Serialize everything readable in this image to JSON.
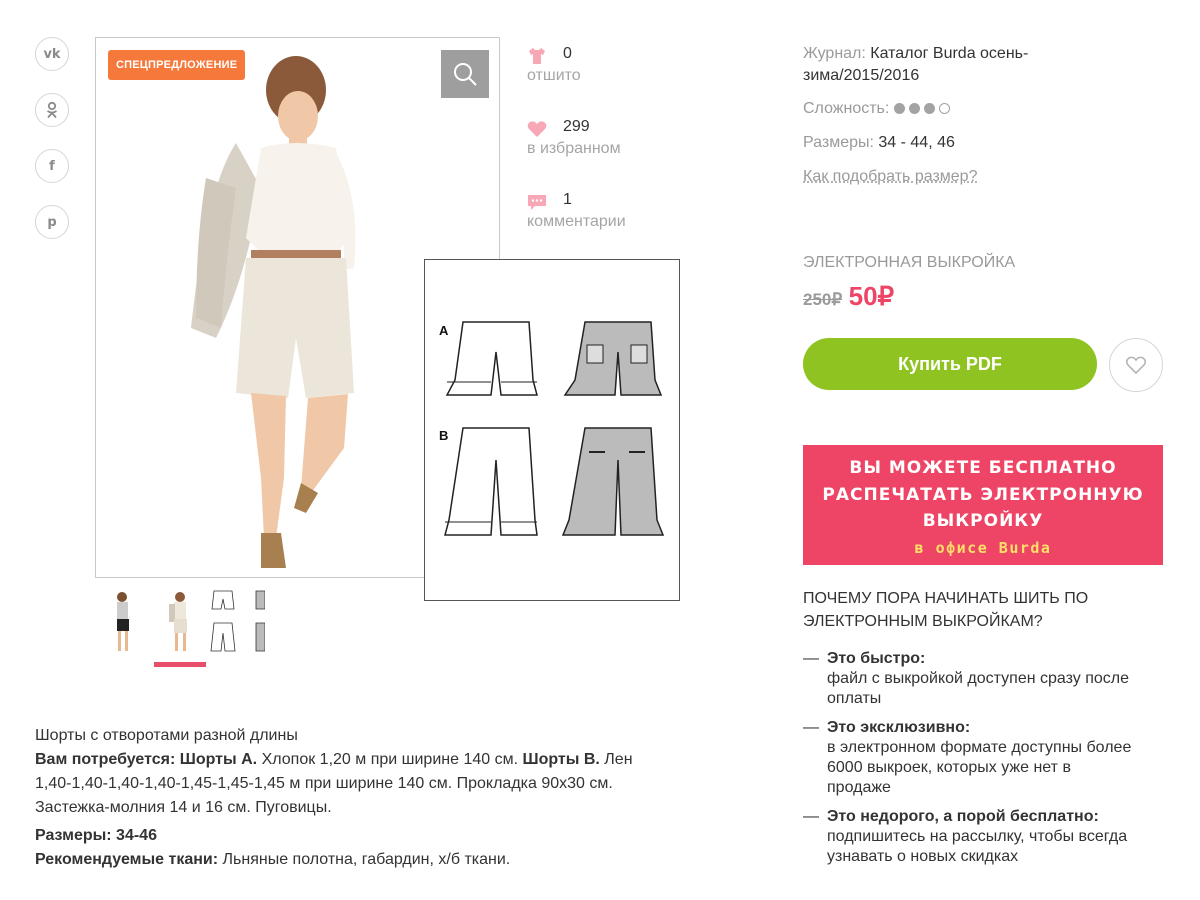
{
  "social": {
    "vk": "vk",
    "ok": "ok",
    "fb": "f",
    "pinterest": "p"
  },
  "gallery": {
    "badge": "СПЕЦПРЕДЛОЖЕНИЕ",
    "badge_color": "#f5793b",
    "active_thumb_index": 1,
    "active_color": "#e94f6a"
  },
  "stats": {
    "sewn_count": "0",
    "sewn_label": "отшито",
    "fav_count": "299",
    "fav_label": "в избранном",
    "comments_count": "1",
    "comments_label": "комментарии"
  },
  "drawing": {
    "view_a": "A",
    "view_b": "B"
  },
  "description": {
    "title": "Шорты с отворотами разной длины",
    "needs_label": "Вам потребуется:",
    "shorts_a_label": "Шорты А.",
    "shorts_a_text": "Хлопок 1,20 м при ширине 140 см.",
    "shorts_b_label": "Шорты В.",
    "shorts_b_text": "Лен 1,40-1,40-1,40-1,40-1,45-1,45-1,45 м при ширине 140 см. Прокладка 90х30 см. Застежка-молния 14 и 16 см. Пуговицы.",
    "sizes": "Размеры: 34-46",
    "fabrics_label": "Рекомендуемые ткани:",
    "fabrics_text": "Льняные полотна, габардин, х/б ткани."
  },
  "info": {
    "magazine_label": "Журнал:",
    "magazine_line1": "Каталог Burda осень-",
    "magazine_line2": "зима/2015/2016",
    "difficulty_label": "Сложность:",
    "difficulty_level": 3,
    "difficulty_max": 4,
    "sizes_label": "Размеры:",
    "sizes_value": "34 - 44, 46",
    "size_help_link": "Как подобрать размер?"
  },
  "purchase": {
    "type_label": "ЭЛЕКТРОННАЯ ВЫКРОЙКА",
    "old_price": "250₽",
    "new_price": "50₽",
    "buy_label": "Купить PDF",
    "buy_color": "#8fc321",
    "price_color": "#ee4466"
  },
  "promo": {
    "line1": "ВЫ МОЖЕТЕ БЕСПЛАТНО",
    "line2": "РАСПЕЧАТАТЬ ЭЛЕКТРОННУЮ",
    "line3": "ВЫКРОЙКУ",
    "line4": "в офисе Burda",
    "bg_color": "#ee4466"
  },
  "why": {
    "heading_line1": "ПОЧЕМУ ПОРА НАЧИНАТЬ ШИТЬ ПО",
    "heading_line2": "ЭЛЕКТРОННЫМ ВЫКРОЙКАМ?",
    "items": [
      {
        "title": "Это быстро:",
        "line1": "файл с выкройкой доступен сразу после",
        "line2": "оплаты",
        "line3": ""
      },
      {
        "title": "Это эксклюзивно:",
        "line1": "в электронном формате доступны более",
        "line2": "6000 выкроек, которых уже нет в",
        "line3": "продаже"
      },
      {
        "title": "Это недорого, а порой бесплатно:",
        "line1": "подпишитесь на рассылку, чтобы всегда",
        "line2": "узнавать о новых скидках",
        "line3": ""
      }
    ]
  }
}
